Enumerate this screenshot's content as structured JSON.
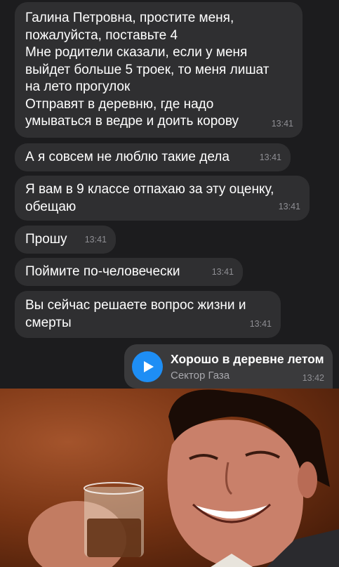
{
  "messages": [
    {
      "text": "Галина Петровна, простите меня,\nпожалуйста, поставьте 4\nМне родители сказали, если у меня\nвыйдет больше 5 троек, то меня лишат\nна лето прогулок\nОтправят в деревню, где надо\nумываться в ведре и доить корову",
      "time": "13:41"
    },
    {
      "text": "А я совсем не люблю такие дела",
      "time": "13:41"
    },
    {
      "text": "Я вам в 9 классе отпахаю за эту оценку,\nобещаю",
      "time": "13:41"
    },
    {
      "text": "Прошу",
      "time": "13:41"
    },
    {
      "text": "Поймите по-человечески",
      "time": "13:41"
    },
    {
      "text": "Вы сейчас решаете вопрос жизни и\nсмерты",
      "time": "13:41"
    }
  ],
  "audio": {
    "title": "Хорошо в деревне летом",
    "artist": "Сектор Газа",
    "time": "13:42",
    "icon": "play-icon",
    "accent": "#1e8ef5"
  },
  "photo": {
    "icon": "laughing-man-photo"
  }
}
